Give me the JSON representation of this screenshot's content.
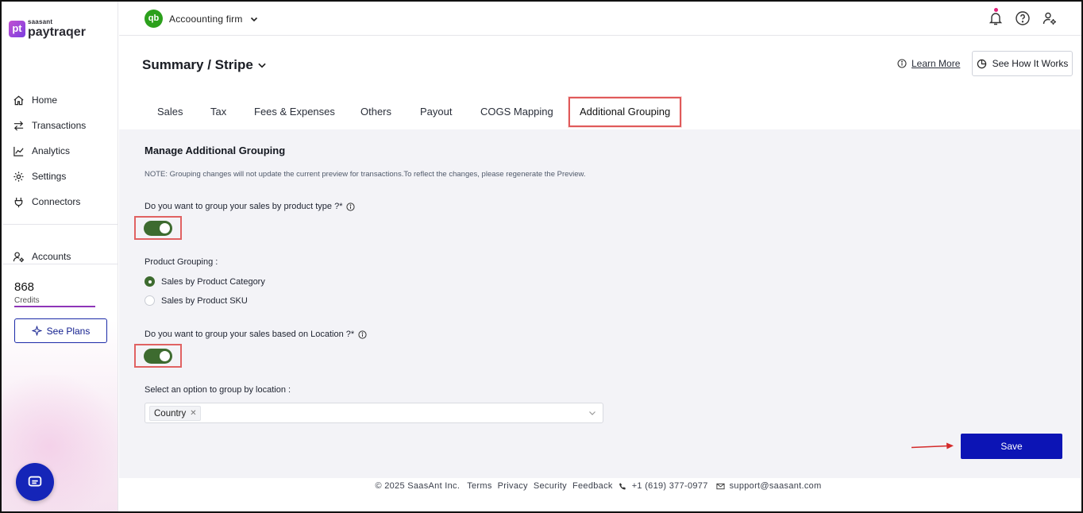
{
  "brand": {
    "small": "saasant",
    "big": "paytraqer",
    "badge": "pt"
  },
  "sidebar": {
    "items": [
      {
        "label": "Home",
        "icon": "home-icon"
      },
      {
        "label": "Transactions",
        "icon": "transactions-icon"
      },
      {
        "label": "Analytics",
        "icon": "analytics-icon"
      },
      {
        "label": "Settings",
        "icon": "gear-icon"
      },
      {
        "label": "Connectors",
        "icon": "plug-icon"
      }
    ],
    "accounts": "Accounts",
    "credits_value": "868",
    "credits_label": "Credits",
    "see_plans": "See Plans"
  },
  "topbar": {
    "company_logo": "qb",
    "company": "Accoounting firm"
  },
  "header": {
    "title": "Summary / Stripe",
    "learn_more": "Learn More",
    "see_how": "See How It Works"
  },
  "tabs": [
    {
      "label": "Sales"
    },
    {
      "label": "Tax"
    },
    {
      "label": "Fees & Expenses"
    },
    {
      "label": "Others"
    },
    {
      "label": "Payout"
    },
    {
      "label": "COGS Mapping"
    },
    {
      "label": "Additional Grouping",
      "active": true
    }
  ],
  "main": {
    "section_title": "Manage Additional Grouping",
    "note": "NOTE: Grouping changes will not update the current preview for transactions.To reflect the changes, please regenerate the Preview.",
    "q1": "Do you want to group your sales by product type ?*",
    "q1_enabled": true,
    "product_grouping_label": "Product Grouping :",
    "radio_options": [
      {
        "label": "Sales by Product Category",
        "selected": true
      },
      {
        "label": "Sales by Product SKU",
        "selected": false
      }
    ],
    "q2": "Do you want to group your sales based on Location ?*",
    "q2_enabled": true,
    "location_label": "Select an option to group by location :",
    "location_chip": "Country",
    "save": "Save"
  },
  "footer": {
    "copyright": "© 2025 SaasAnt Inc.",
    "links": [
      "Terms",
      "Privacy",
      "Security",
      "Feedback"
    ],
    "phone": "+1 (619) 377-0977",
    "email": "support@saasant.com"
  },
  "colors": {
    "accent": "#0c14b5",
    "toggle_on": "#3d6b2f",
    "highlight": "#e06262",
    "qb_green": "#2ca01c"
  }
}
